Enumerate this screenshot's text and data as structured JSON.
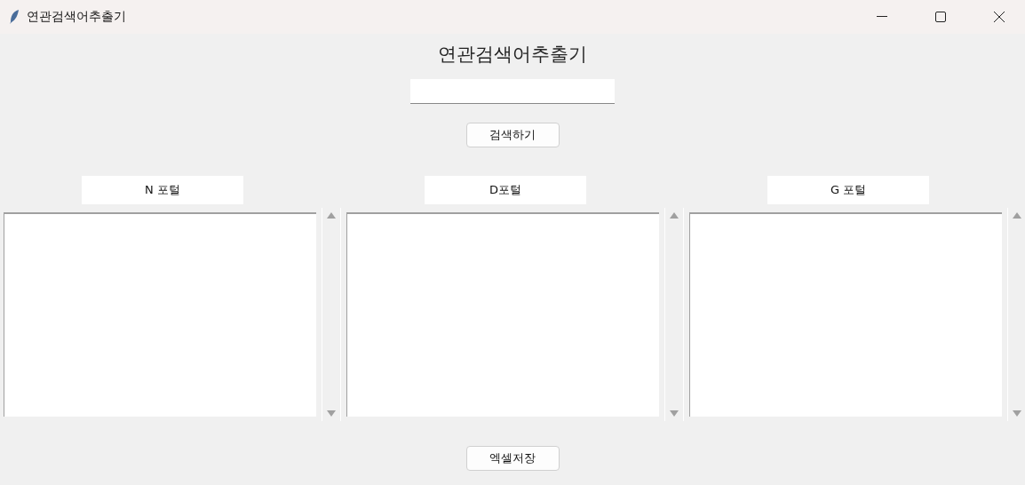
{
  "window": {
    "title": "연관검색어추출기"
  },
  "heading": "연관검색어추출기",
  "search_button": "검색하기",
  "portals": [
    {
      "label": "N 포털"
    },
    {
      "label": "D포털"
    },
    {
      "label": "G 포털"
    }
  ],
  "save_button": "엑셀저장"
}
